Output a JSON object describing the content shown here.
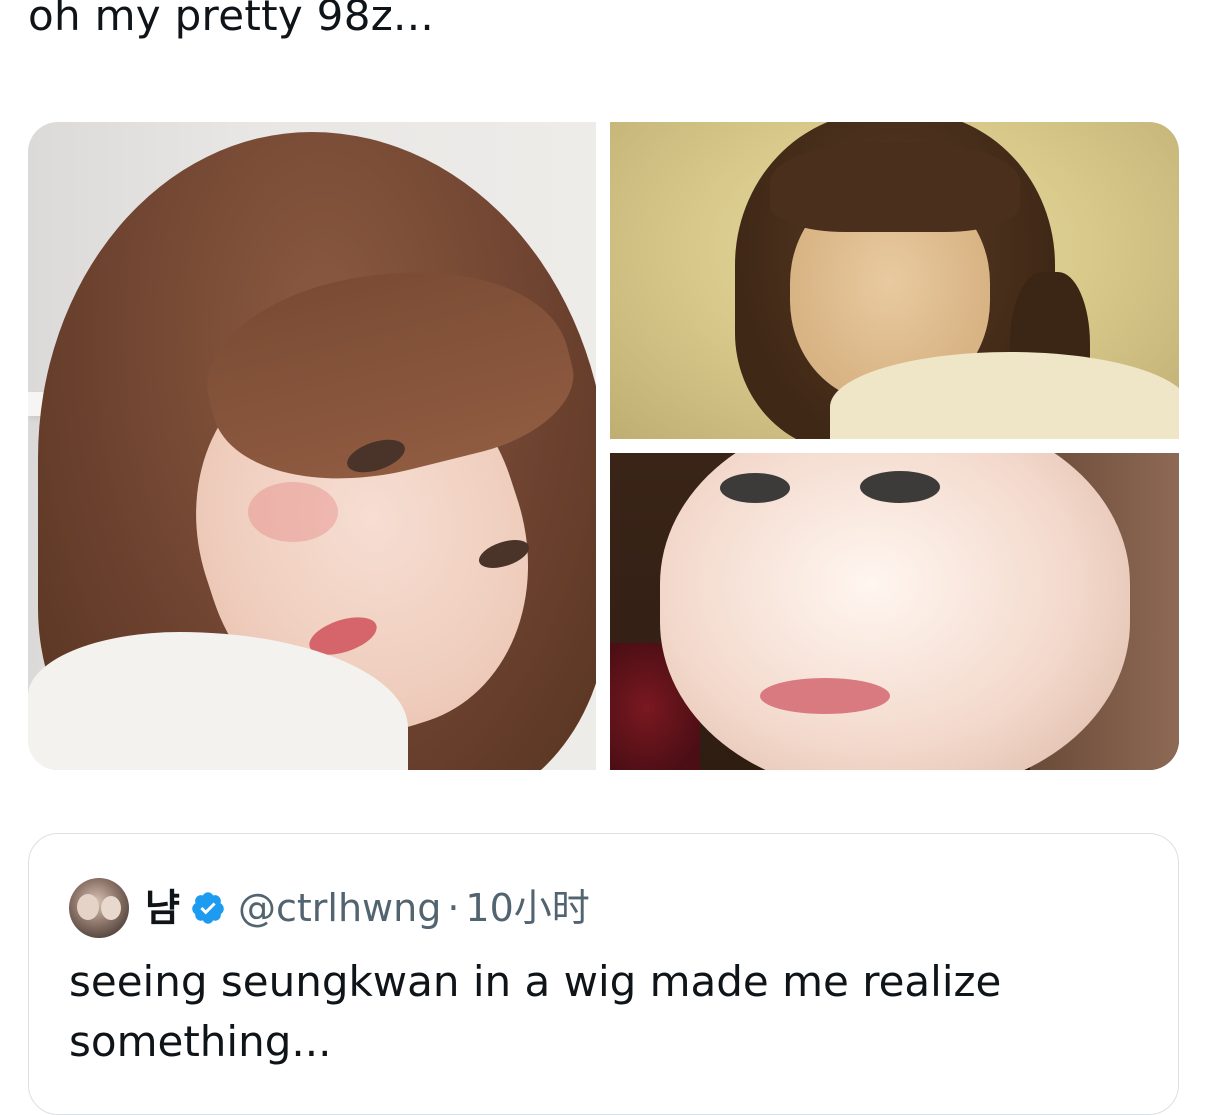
{
  "tweet": {
    "text": "oh my pretty 98z..."
  },
  "media": [
    {
      "name": "photo-1"
    },
    {
      "name": "photo-2"
    },
    {
      "name": "photo-3"
    }
  ],
  "quote": {
    "display_name": "냠",
    "handle": "@ctrlhwng",
    "separator": "·",
    "time": "10小时",
    "text": "seeing seungkwan in a wig made me realize something..."
  },
  "colors": {
    "text": "#0f1419",
    "secondary": "#536471",
    "verified": "#1d9bf0",
    "border": "#dbe0e4"
  }
}
